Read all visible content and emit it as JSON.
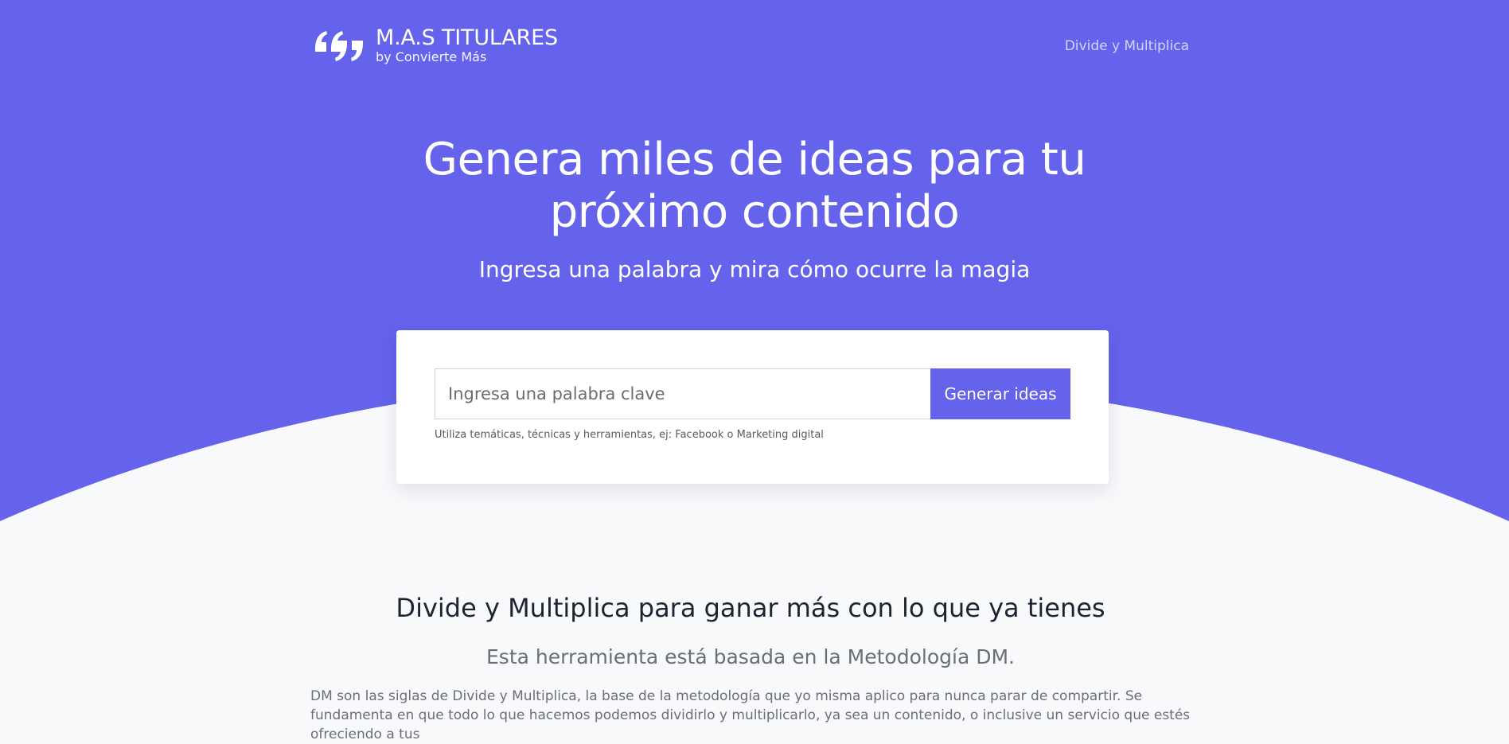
{
  "colors": {
    "brand": "#6562ec",
    "background_light": "#f8f9fb",
    "card": "#ffffff",
    "text_dark": "#1f2230",
    "text_muted": "#6b6d77"
  },
  "header": {
    "logo_title": "M.A.S TITULARES",
    "logo_subtitle": "by Convierte Más",
    "logo_icon": "quote-marks-icon",
    "nav_link": "Divide y Multiplica"
  },
  "hero": {
    "title": "Genera miles de ideas para tu\npróximo contenido",
    "subtitle": "Ingresa una palabra y mira cómo ocurre la magia"
  },
  "search": {
    "placeholder": "Ingresa una palabra clave",
    "value": "",
    "button_label": "Generar ideas",
    "hint": "Utiliza temáticas, técnicas y herramientas, ej: Facebook o Marketing digital"
  },
  "section": {
    "title": "Divide y Multiplica para ganar más con lo que ya tienes",
    "subtitle": "Esta herramienta está basada en la Metodología DM.",
    "body": "DM son las siglas de Divide y Multiplica, la base de la metodología que yo misma aplico para nunca parar de compartir. Se fundamenta en que todo lo que hacemos podemos dividirlo y multiplicarlo, ya sea un contenido, o inclusive un servicio que estés ofreciendo a tus"
  }
}
